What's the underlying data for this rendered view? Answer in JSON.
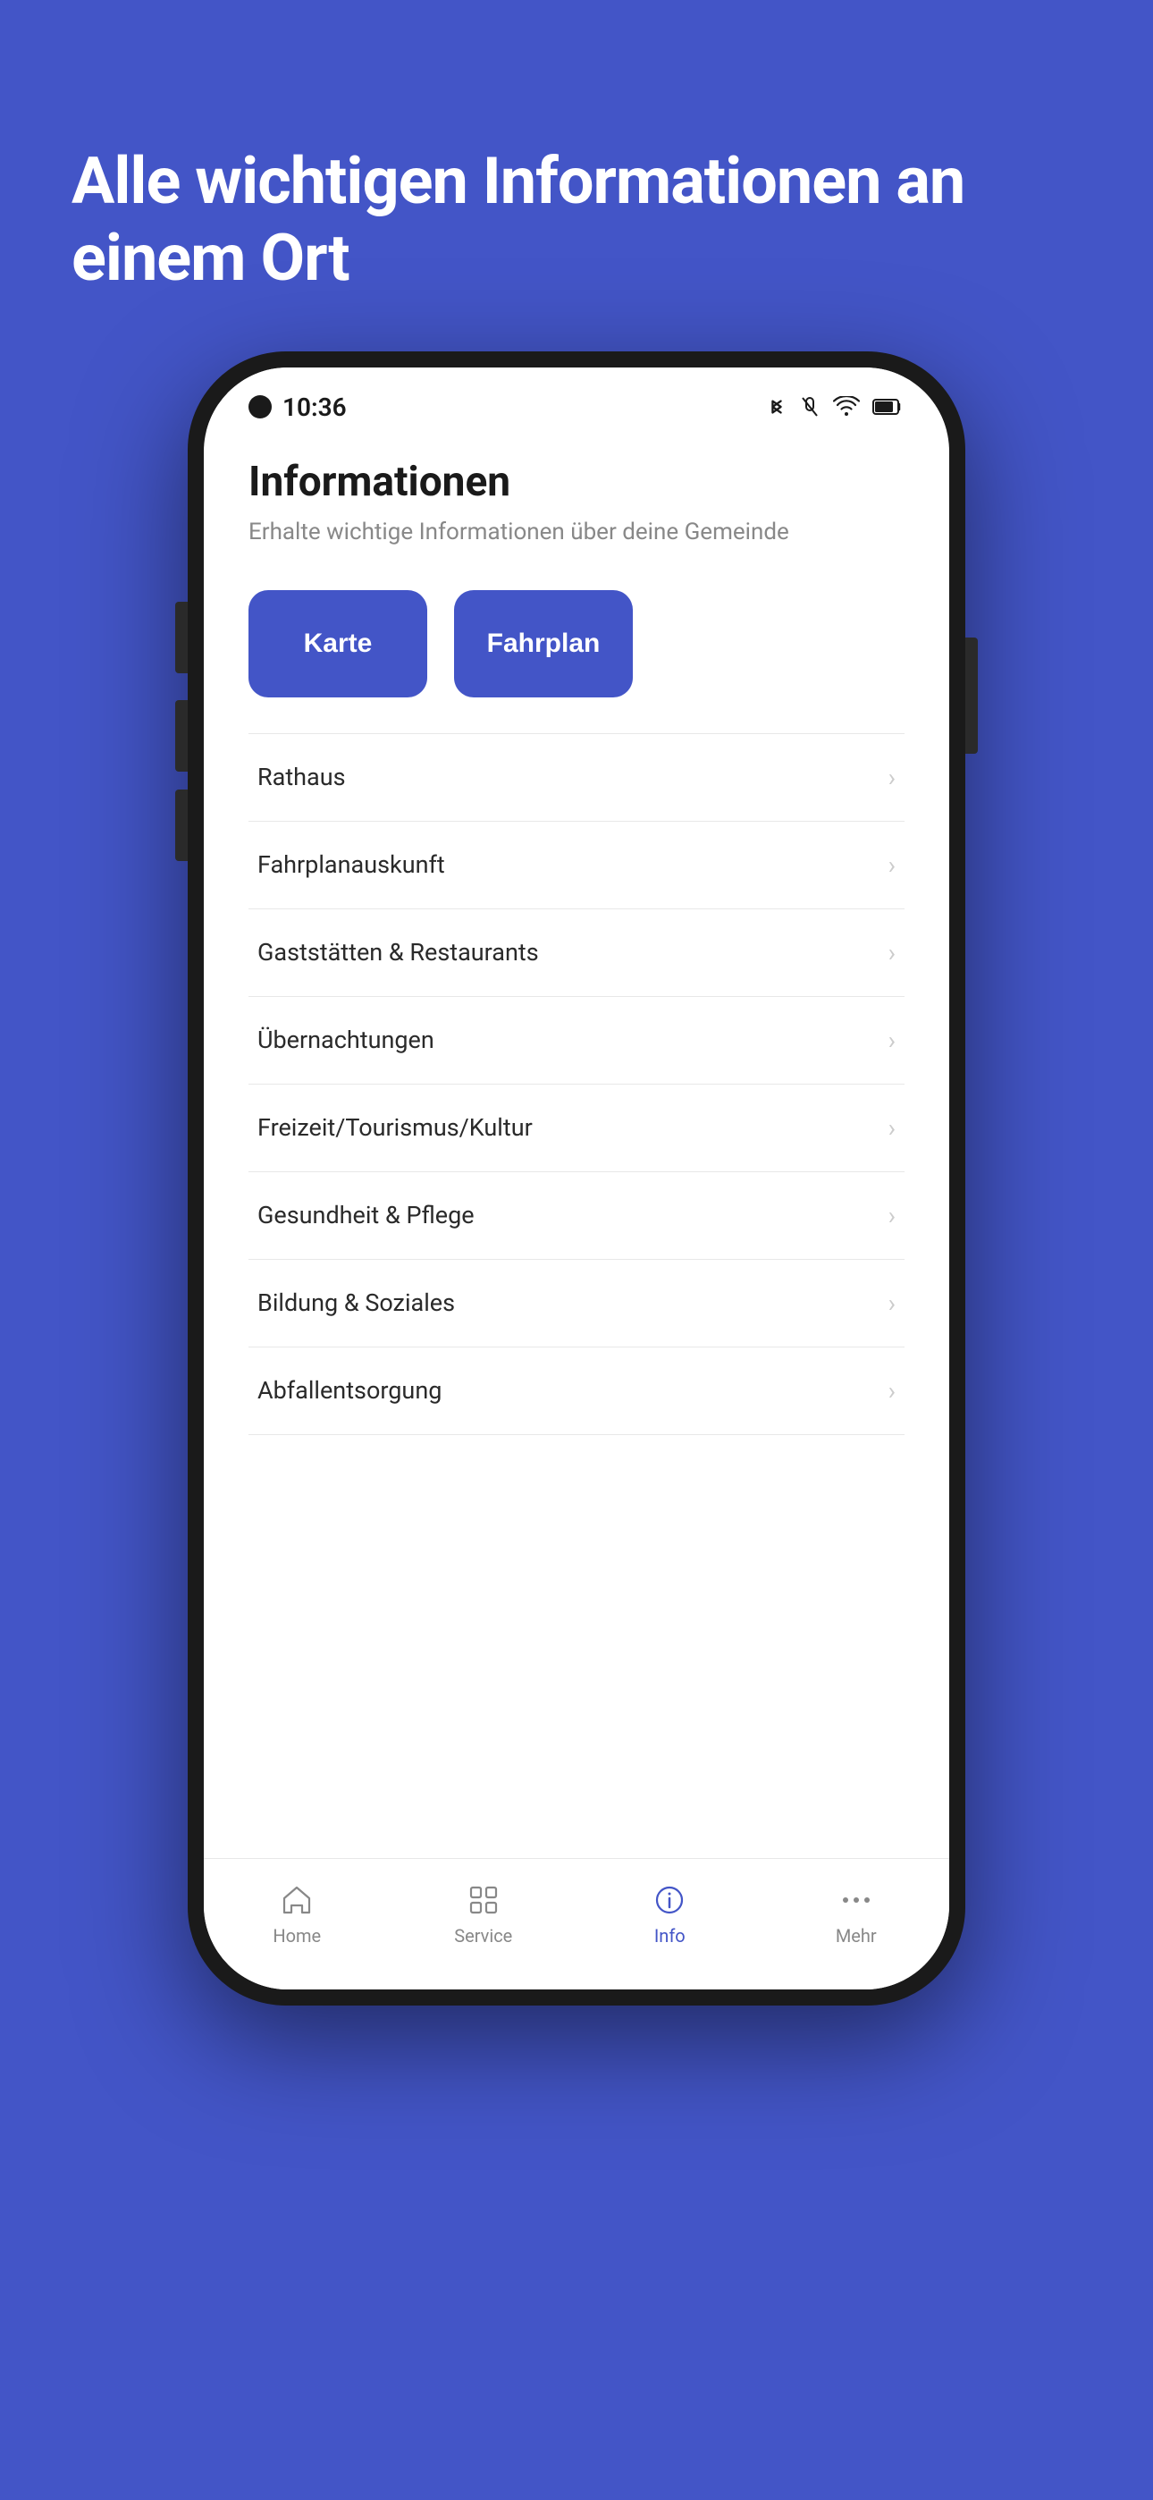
{
  "background_color": "#4355c7",
  "hero": {
    "title": "Alle wichtigen Informationen an einem Ort"
  },
  "phone": {
    "status_bar": {
      "time": "10:36",
      "icons": [
        "bluetooth",
        "mute",
        "wifi",
        "battery"
      ]
    },
    "app": {
      "page_title": "Informationen",
      "page_subtitle": "Erhalte wichtige Informationen über deine Gemeinde",
      "quick_buttons": [
        {
          "label": "Karte",
          "id": "karte"
        },
        {
          "label": "Fahrplan",
          "id": "fahrplan"
        }
      ],
      "menu_items": [
        {
          "label": "Rathaus",
          "id": "rathaus"
        },
        {
          "label": "Fahrplanauskunft",
          "id": "fahrplanauskunft"
        },
        {
          "label": "Gaststätten & Restaurants",
          "id": "gaststätten"
        },
        {
          "label": "Übernachtungen",
          "id": "uebernachtungen"
        },
        {
          "label": "Freizeit/Tourismus/Kultur",
          "id": "freizeit"
        },
        {
          "label": "Gesundheit & Pflege",
          "id": "gesundheit"
        },
        {
          "label": "Bildung & Soziales",
          "id": "bildung"
        },
        {
          "label": "Abfallentsorgung",
          "id": "abfallentsorgung"
        }
      ],
      "bottom_nav": [
        {
          "label": "Home",
          "icon": "home",
          "active": false
        },
        {
          "label": "Service",
          "icon": "grid",
          "active": false
        },
        {
          "label": "Info",
          "icon": "info",
          "active": true
        },
        {
          "label": "Mehr",
          "icon": "more",
          "active": false
        }
      ]
    }
  }
}
